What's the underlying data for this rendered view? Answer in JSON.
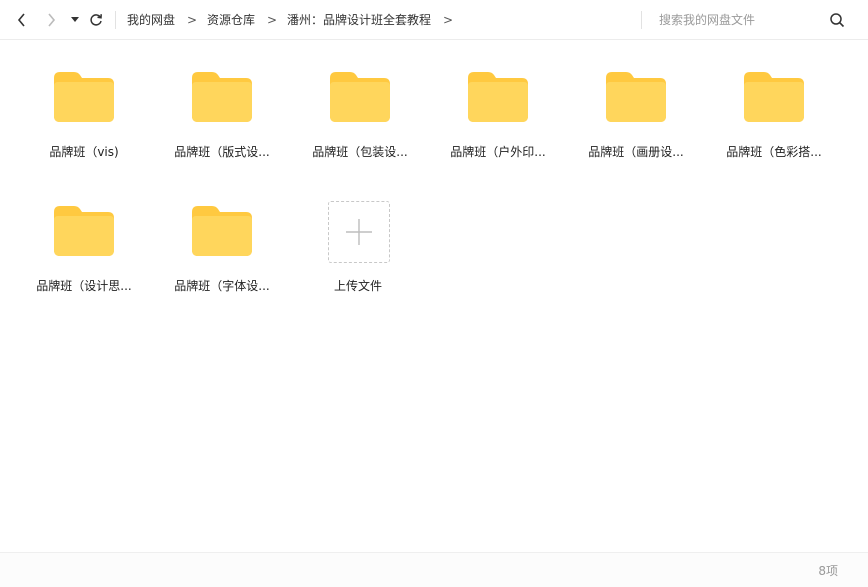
{
  "toolbar": {
    "back_icon": "chevron-left-icon",
    "forward_icon": "chevron-right-icon",
    "history_icon": "caret-down-icon",
    "refresh_icon": "refresh-icon"
  },
  "breadcrumb": {
    "items": [
      "我的网盘",
      "资源仓库",
      "潘州：品牌设计班全套教程"
    ],
    "separator": ">"
  },
  "search": {
    "placeholder": "搜索我的网盘文件",
    "icon": "search-icon"
  },
  "files": [
    {
      "name": "品牌班（vis)",
      "type": "folder"
    },
    {
      "name": "品牌班（版式设...",
      "type": "folder"
    },
    {
      "name": "品牌班（包装设...",
      "type": "folder"
    },
    {
      "name": "品牌班（户外印...",
      "type": "folder"
    },
    {
      "name": "品牌班（画册设...",
      "type": "folder"
    },
    {
      "name": "品牌班（色彩搭...",
      "type": "folder"
    },
    {
      "name": "品牌班（设计思...",
      "type": "folder"
    },
    {
      "name": "品牌班（字体设...",
      "type": "folder"
    }
  ],
  "upload": {
    "label": "上传文件",
    "icon": "plus-icon"
  },
  "status": {
    "count": "8项"
  },
  "colors": {
    "folder": "#FFD65C",
    "folder_tab": "#FFC940"
  }
}
